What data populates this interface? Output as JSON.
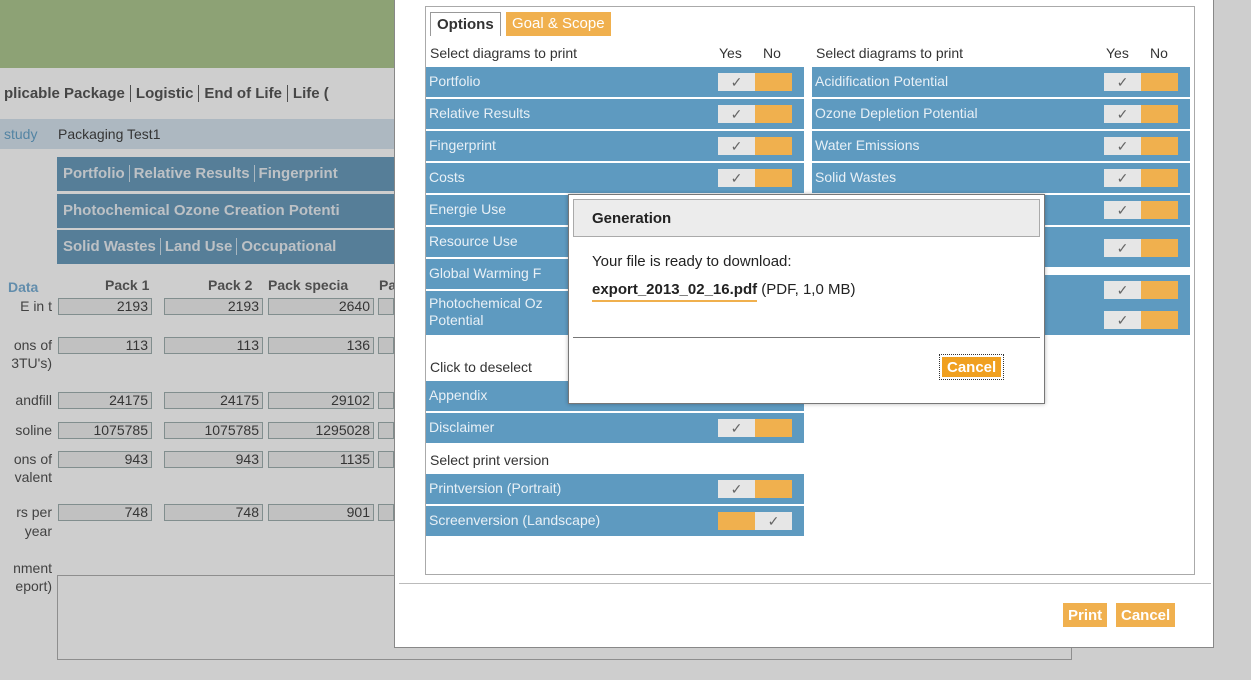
{
  "background": {
    "package_nav": [
      "plicable Package",
      "Logistic",
      "End of Life",
      "Life ("
    ],
    "study_label": "study",
    "study_value": "Packaging Test1",
    "report_tabs_1": [
      "Portfolio",
      "Relative Results",
      "Fingerprint"
    ],
    "report_tabs_2": [
      "Photochemical Ozone Creation Potenti"
    ],
    "report_tabs_3": [
      "Solid Wastes",
      "Land Use",
      "Occupational"
    ],
    "data_label": "Data",
    "pack_headers": [
      "Pack 1",
      "Pack 2",
      "Pack specia",
      "Pa"
    ],
    "row_labels": [
      "E in t",
      "ons of",
      "3TU's)",
      "andfill",
      "soline",
      "ons of",
      "valent",
      "rs per",
      "year",
      "nment",
      "eport)"
    ],
    "rows": [
      [
        "2193",
        "2193",
        "2640"
      ],
      [
        "113",
        "113",
        "136"
      ],
      [
        "24175",
        "24175",
        "29102"
      ],
      [
        "1075785",
        "1075785",
        "1295028"
      ],
      [
        "943",
        "943",
        "1135"
      ],
      [
        "748",
        "748",
        "901"
      ]
    ]
  },
  "options_panel": {
    "tabs": [
      {
        "label": "Options",
        "active": true
      },
      {
        "label": "Goal & Scope",
        "active": false
      }
    ],
    "left_section_title": "Select diagrams to print",
    "right_section_title": "Select diagrams to print",
    "yes_label": "Yes",
    "no_label": "No",
    "check_glyph": "✓",
    "left_items": [
      {
        "label": "Portfolio",
        "selected": "yes"
      },
      {
        "label": "Relative Results",
        "selected": "yes"
      },
      {
        "label": "Fingerprint",
        "selected": "yes"
      },
      {
        "label": "Costs",
        "selected": "yes"
      },
      {
        "label": "Energie Use",
        "selected": "yes"
      },
      {
        "label": "Resource Use",
        "selected": "yes"
      },
      {
        "label": "Global Warming F",
        "selected": "yes"
      },
      {
        "label": "Photochemical Oz",
        "label2": "Potential",
        "selected": "yes"
      }
    ],
    "right_items": [
      {
        "label": "Acidification Potential",
        "selected": "yes"
      },
      {
        "label": "Ozone Depletion Potential",
        "selected": "yes"
      },
      {
        "label": "Water Emissions",
        "selected": "yes"
      },
      {
        "label": "Solid Wastes",
        "selected": "yes"
      },
      {
        "label": "",
        "selected": "yes"
      },
      {
        "label": "",
        "selected": "yes"
      },
      {
        "label": "",
        "selected": "yes"
      },
      {
        "label": "",
        "selected": "yes"
      }
    ],
    "deselect_title": "Click to deselect",
    "deselect_items": [
      {
        "label": "Appendix",
        "selected": "yes"
      },
      {
        "label": "Disclaimer",
        "selected": "yes"
      }
    ],
    "version_title": "Select print version",
    "version_items": [
      {
        "label": "Printversion (Portrait)",
        "selected": "yes"
      },
      {
        "label": "Screenversion (Landscape)",
        "selected": "no"
      }
    ],
    "print_button": "Print",
    "cancel_button": "Cancel"
  },
  "modal": {
    "title": "Generation",
    "message": "Your file is ready to download:",
    "file_name": "export_2013_02_16.pdf",
    "file_info": "(PDF, 1,0 MB)",
    "cancel_button": "Cancel"
  },
  "colors": {
    "accent_orange": "#f0b04e",
    "row_blue": "#5e9ac0",
    "header_green": "#a8c488"
  }
}
